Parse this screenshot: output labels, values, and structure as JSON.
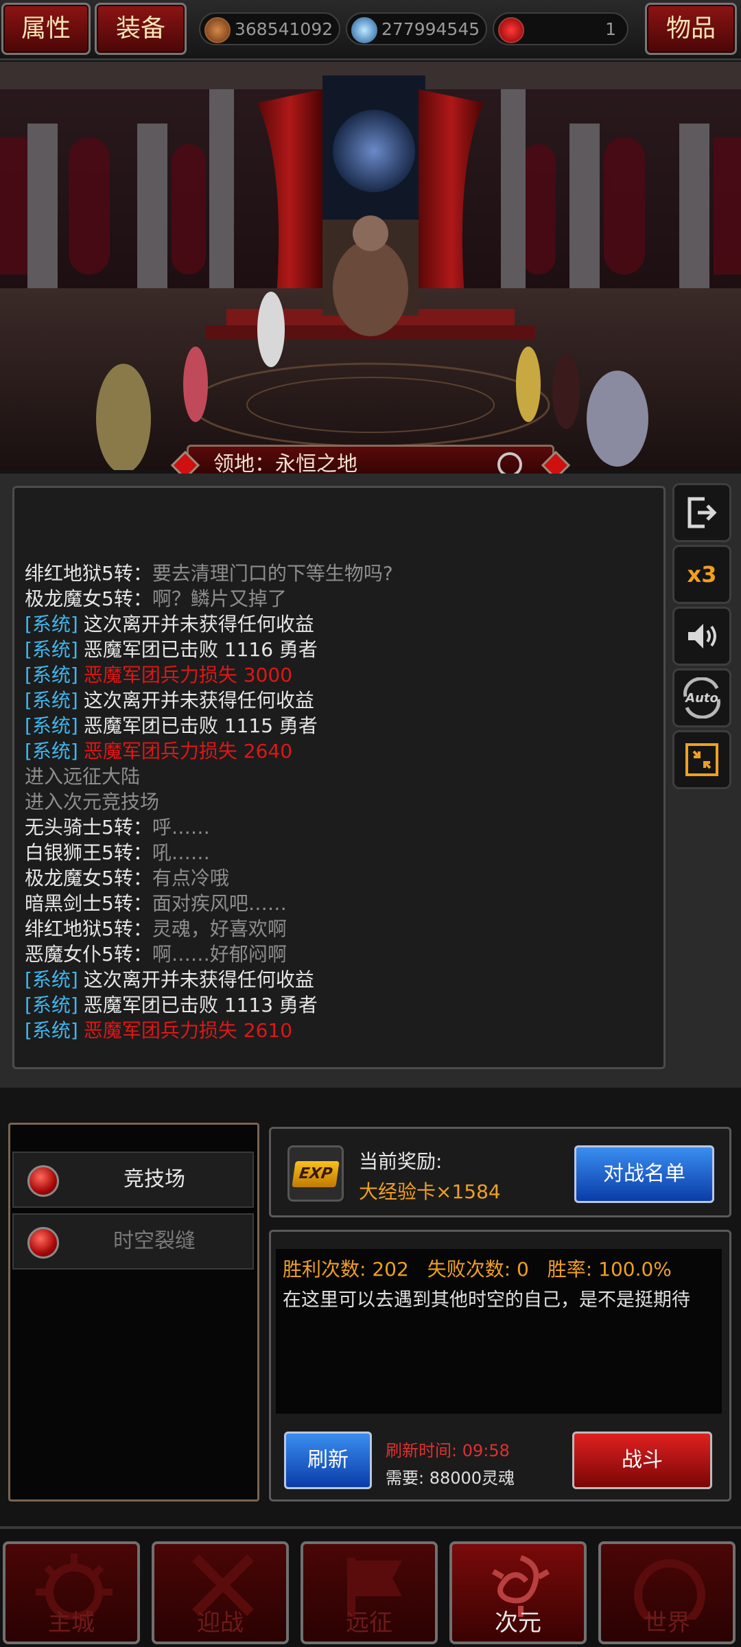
{
  "topbar": {
    "attributes_label": "属性",
    "equipment_label": "装备",
    "items_label": "物品",
    "resources": [
      {
        "icon": "gold-medal-icon",
        "value": "368541092"
      },
      {
        "icon": "blue-soul-gem-icon",
        "value": "277994545"
      },
      {
        "icon": "red-swirl-orb-icon",
        "value": "1"
      }
    ]
  },
  "scene": {
    "territory_label": "领地：永恒之地"
  },
  "chat": {
    "lines": [
      {
        "name": "绯红地狱5转：",
        "text": "要去清理门口的下等生物吗?"
      },
      {
        "name": "极龙魔女5转：",
        "text": "啊？鳞片又掉了"
      },
      {
        "tag": "[系统]",
        "text": "这次离开并未获得任何收益"
      },
      {
        "tag": "[系统]",
        "text": "恶魔军团已击败 1116 勇者"
      },
      {
        "tag": "[系统]",
        "text": "恶魔军团兵力损失 3000",
        "alert": true
      },
      {
        "tag": "[系统]",
        "text": "这次离开并未获得任何收益"
      },
      {
        "tag": "[系统]",
        "text": "恶魔军团已击败 1115 勇者"
      },
      {
        "tag": "[系统]",
        "text": "恶魔军团兵力损失 2640",
        "alert": true
      },
      {
        "text": "进入远征大陆",
        "plain": true
      },
      {
        "text": "进入次元竞技场",
        "plain": true
      },
      {
        "name": "无头骑士5转：",
        "text": "呼……"
      },
      {
        "name": "白银狮王5转：",
        "text": "吼……"
      },
      {
        "name": "极龙魔女5转：",
        "text": "有点冷哦"
      },
      {
        "name": "暗黑剑士5转：",
        "text": "面对疾风吧……"
      },
      {
        "name": "绯红地狱5转：",
        "text": "灵魂，好喜欢啊"
      },
      {
        "name": "恶魔女仆5转：",
        "text": "啊……好郁闷啊"
      },
      {
        "tag": "[系统]",
        "text": "这次离开并未获得任何收益"
      },
      {
        "tag": "[系统]",
        "text": "恶魔军团已击败 1113 勇者"
      },
      {
        "tag": "[系统]",
        "text": "恶魔军团兵力损失 2610",
        "alert": true
      }
    ]
  },
  "side": {
    "speed_label": "x3"
  },
  "menu": {
    "items": [
      {
        "label": "竞技场",
        "active": true
      },
      {
        "label": "时空裂缝",
        "active": false
      }
    ]
  },
  "reward": {
    "title": "当前奖励:",
    "value": "大经验卡×1584",
    "badge_text": "EXP",
    "roster_button": "对战名单"
  },
  "stats": {
    "wins_label": "胜利次数:",
    "wins": "202",
    "losses_label": "失败次数:",
    "losses": "0",
    "rate_label": "胜率:",
    "rate": "100.0%",
    "description": "在这里可以去遇到其他时空的自己，是不是挺期待"
  },
  "actions": {
    "refresh_button": "刷新",
    "refresh_time_label": "刷新时间:",
    "refresh_time": "09:58",
    "cost_text": "需要: 88000灵魂",
    "fight_button": "战斗"
  },
  "nav": {
    "items": [
      {
        "label": "主城",
        "icon": "sun-gear-icon"
      },
      {
        "label": "迎战",
        "icon": "crossed-swords-icon"
      },
      {
        "label": "远征",
        "icon": "flag-icon"
      },
      {
        "label": "次元",
        "icon": "dimension-swirl-icon"
      },
      {
        "label": "世界",
        "icon": "globe-icon"
      }
    ]
  },
  "colors": {
    "system_tag": "#3fb8f0",
    "alert_text": "#e01616",
    "reward_value": "#f0a020",
    "refresh_time": "#e03030"
  }
}
